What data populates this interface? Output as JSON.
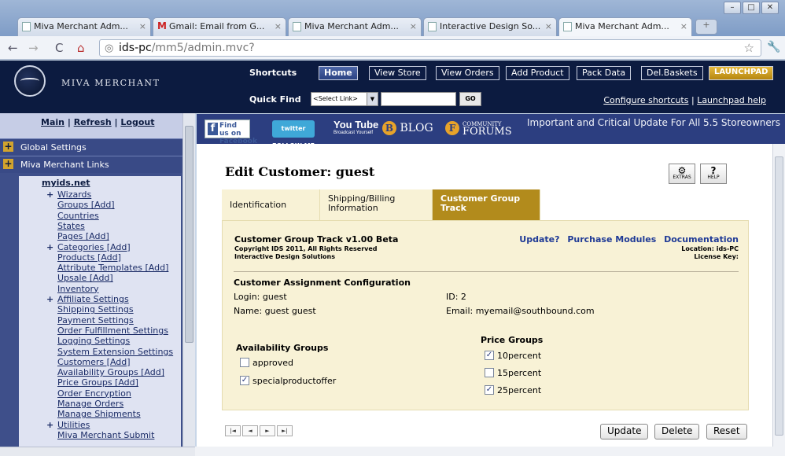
{
  "browser": {
    "tabs": [
      {
        "label": "Miva Merchant Adm...",
        "favicon": "page-icon",
        "active": false
      },
      {
        "label": "Gmail: Email from G...",
        "favicon": "gmail-icon",
        "active": false
      },
      {
        "label": "Miva Merchant Adm...",
        "favicon": "page-icon",
        "active": false
      },
      {
        "label": "Interactive Design So...",
        "favicon": "page-icon",
        "active": false
      },
      {
        "label": "Miva Merchant Adm...",
        "favicon": "page-icon",
        "active": true
      }
    ],
    "url_host": "ids-pc",
    "url_path": "/mm5/admin.mvc?"
  },
  "header": {
    "brand": "MIVA MERCHANT",
    "shortcuts_label": "Shortcuts",
    "shortcuts": [
      "Home",
      "View Store",
      "View Orders",
      "Add Product",
      "Pack Data",
      "Del.Baskets",
      "LAUNCHPAD"
    ],
    "quick_find_label": "Quick Find",
    "quick_find_select": "<Select Link>",
    "go_label": "GO",
    "configure_link": "Configure shortcuts",
    "separator": "|",
    "launchpad_help_link": "Launchpad help"
  },
  "sidebar": {
    "main_link": "Main",
    "refresh_link": "Refresh",
    "logout_link": "Logout",
    "sep": "|",
    "sections": [
      "Global Settings",
      "Miva Merchant Links"
    ],
    "store": "myids.net",
    "items": [
      {
        "label": "Wizards",
        "plus": true
      },
      {
        "label": "Groups [Add]",
        "plus": false
      },
      {
        "label": "Countries",
        "plus": false
      },
      {
        "label": "States",
        "plus": false
      },
      {
        "label": "Pages [Add]",
        "plus": false
      },
      {
        "label": "Categories [Add]",
        "plus": true
      },
      {
        "label": "Products [Add]",
        "plus": false
      },
      {
        "label": "Attribute Templates [Add]",
        "plus": false
      },
      {
        "label": "Upsale [Add]",
        "plus": false
      },
      {
        "label": "Inventory",
        "plus": false
      },
      {
        "label": "Affiliate Settings",
        "plus": true
      },
      {
        "label": "Shipping Settings",
        "plus": false
      },
      {
        "label": "Payment Settings",
        "plus": false
      },
      {
        "label": "Order Fulfillment Settings",
        "plus": false
      },
      {
        "label": "Logging Settings",
        "plus": false
      },
      {
        "label": "System Extension Settings",
        "plus": false
      },
      {
        "label": "Customers [Add]",
        "plus": false
      },
      {
        "label": "Availability Groups [Add]",
        "plus": false
      },
      {
        "label": "Price Groups [Add]",
        "plus": false
      },
      {
        "label": "Order Encryption",
        "plus": false
      },
      {
        "label": "Manage Orders",
        "plus": false
      },
      {
        "label": "Manage Shipments",
        "plus": false
      },
      {
        "label": "Utilities",
        "plus": true
      },
      {
        "label": "Miva Merchant Submit",
        "plus": false
      }
    ]
  },
  "banner": {
    "facebook": "Find us on Facebook",
    "twitter": "twitter FOLLOW ME",
    "youtube": "You Tube",
    "youtube_sub": "Broadcast Yourself",
    "blog": "BLOG",
    "community": "COMMUNITY",
    "forums": "FORUMS",
    "notice": "Important and Critical Update For All 5.5 Storeowners"
  },
  "page": {
    "title": "Edit Customer: guest",
    "extras": "EXTRAS",
    "help": "HELP",
    "tabs": [
      "Identification",
      "Shipping/Billing Information",
      "Customer Group Track"
    ],
    "module_title": "Customer Group Track  v1.00 Beta",
    "copyright": "Copyright IDS 2011, All Rights Reserved",
    "company": "Interactive Design Solutions",
    "link_update": "Update?",
    "link_purchase": "Purchase Modules",
    "link_docs": "Documentation",
    "location": "Location: ids-PC",
    "license": "License Key:",
    "config_title": "Customer Assignment Configuration",
    "login": "Login: guest",
    "name": "Name: guest guest",
    "id": "ID: 2",
    "email": "Email: myemail@southbound.com",
    "availability_title": "Availability Groups",
    "availability": [
      {
        "label": "approved",
        "checked": false
      },
      {
        "label": "specialproductoffer",
        "checked": true
      }
    ],
    "price_title": "Price Groups",
    "price": [
      {
        "label": "10percent",
        "checked": true
      },
      {
        "label": "15percent",
        "checked": false
      },
      {
        "label": "25percent",
        "checked": true
      }
    ],
    "pager": [
      "|◄",
      "◄",
      "►",
      "►|"
    ],
    "buttons": {
      "update": "Update",
      "delete": "Delete",
      "reset": "Reset"
    }
  }
}
